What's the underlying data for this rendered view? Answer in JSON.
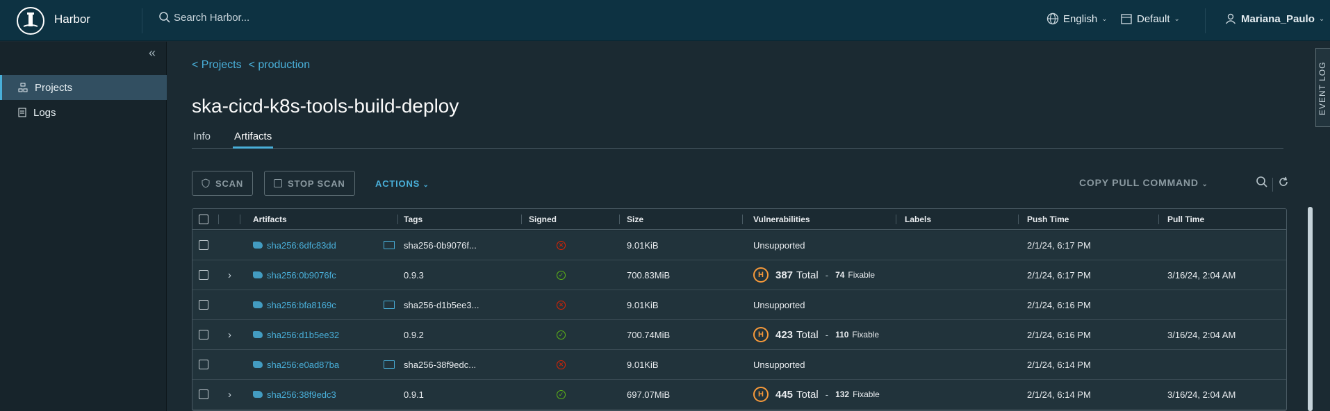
{
  "header": {
    "brand": "Harbor",
    "search_placeholder": "Search Harbor...",
    "language": "English",
    "scheme": "Default",
    "user": "Mariana_Paulo"
  },
  "sidebar": {
    "items": [
      {
        "label": "Projects",
        "active": true
      },
      {
        "label": "Logs",
        "active": false
      }
    ]
  },
  "breadcrumb": {
    "projects": "< Projects",
    "production": "< production"
  },
  "page": {
    "title": "ska-cicd-k8s-tools-build-deploy",
    "tabs": [
      {
        "label": "Info",
        "active": false
      },
      {
        "label": "Artifacts",
        "active": true
      }
    ]
  },
  "toolbar": {
    "scan": "SCAN",
    "stop_scan": "STOP SCAN",
    "actions": "ACTIONS",
    "copy_pull_command": "COPY PULL COMMAND"
  },
  "table": {
    "columns": [
      "Artifacts",
      "Tags",
      "Signed",
      "Size",
      "Vulnerabilities",
      "Labels",
      "Push Time",
      "Pull Time"
    ],
    "rows": [
      {
        "expandable": false,
        "artifact": "sha256:6dfc83dd",
        "folder": true,
        "tags": "sha256-0b9076f...",
        "signed": false,
        "size": "9.01KiB",
        "vuln": {
          "unsupported": "Unsupported"
        },
        "push": "2/1/24, 6:17 PM",
        "pull": ""
      },
      {
        "expandable": true,
        "artifact": "sha256:0b9076fc",
        "folder": false,
        "tags": "0.9.3",
        "signed": true,
        "size": "700.83MiB",
        "vuln": {
          "severity": "H",
          "total": "387",
          "total_label": "Total",
          "fixable": "74",
          "fixable_label": "Fixable"
        },
        "push": "2/1/24, 6:17 PM",
        "pull": "3/16/24, 2:04 AM"
      },
      {
        "expandable": false,
        "artifact": "sha256:bfa8169c",
        "folder": true,
        "tags": "sha256-d1b5ee3...",
        "signed": false,
        "size": "9.01KiB",
        "vuln": {
          "unsupported": "Unsupported"
        },
        "push": "2/1/24, 6:16 PM",
        "pull": ""
      },
      {
        "expandable": true,
        "artifact": "sha256:d1b5ee32",
        "folder": false,
        "tags": "0.9.2",
        "signed": true,
        "size": "700.74MiB",
        "vuln": {
          "severity": "H",
          "total": "423",
          "total_label": "Total",
          "fixable": "110",
          "fixable_label": "Fixable"
        },
        "push": "2/1/24, 6:16 PM",
        "pull": "3/16/24, 2:04 AM"
      },
      {
        "expandable": false,
        "artifact": "sha256:e0ad87ba",
        "folder": true,
        "tags": "sha256-38f9edc...",
        "signed": false,
        "size": "9.01KiB",
        "vuln": {
          "unsupported": "Unsupported"
        },
        "push": "2/1/24, 6:14 PM",
        "pull": ""
      },
      {
        "expandable": true,
        "artifact": "sha256:38f9edc3",
        "folder": false,
        "tags": "0.9.1",
        "signed": true,
        "size": "697.07MiB",
        "vuln": {
          "severity": "H",
          "total": "445",
          "total_label": "Total",
          "fixable": "132",
          "fixable_label": "Fixable"
        },
        "push": "2/1/24, 6:14 PM",
        "pull": "3/16/24, 2:04 AM"
      }
    ]
  },
  "event_log": "EVENT LOG",
  "colors": {
    "accent": "#49afd9",
    "header_bg": "#0d3242",
    "severity_high": "#f89a3a",
    "signed_ok": "#5eb715",
    "signed_no": "#e12200"
  }
}
